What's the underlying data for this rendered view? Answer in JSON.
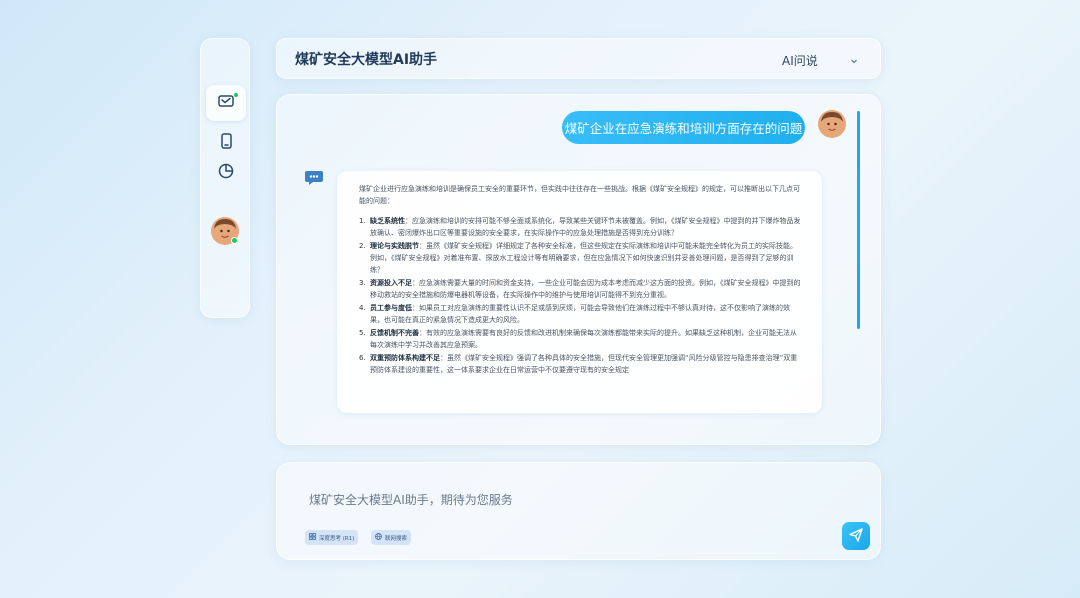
{
  "app": {
    "title": "煤矿安全大模型AI助手"
  },
  "header": {
    "title": "煤矿安全大模型AI助手",
    "mode_label": "AI问说"
  },
  "sidebar": {
    "items": [
      {
        "name": "chat",
        "icon": "mail-check-icon",
        "active": true
      },
      {
        "name": "mobile",
        "icon": "phone-icon",
        "active": false
      },
      {
        "name": "stats",
        "icon": "pie-chart-icon",
        "active": false
      }
    ]
  },
  "chat": {
    "user_message": "煤矿企业在应急演练和培训方面存在的问题",
    "answer_intro": "煤矿企业进行应急演练和培训是确保员工安全的重要环节，但实践中往往存在一些挑战。根据《煤矿安全规程》的规定，可以推断出以下几点可能的问题：",
    "answer_items": [
      {
        "num": "1.",
        "title": "缺乏系统性",
        "text": "：应急演练和培训的安排可能不够全面或系统化，导致某些关键环节未被覆盖。例如，《煤矿安全规程》中提到的井下爆炸物品发放确认、密闭爆炸出口区等重要设施的安全要求，在实际操作中的应急处理措施是否得到充分训练？"
      },
      {
        "num": "2.",
        "title": "理论与实践脱节",
        "text": "：虽然《煤矿安全规程》详细规定了各种安全标准，但这些规定在实际演练和培训中可能未能完全转化为员工的实际技能。例如，《煤矿安全规程》对着准布置、探放水工程设计等有明确要求，但在应急情况下如何快速识别并妥善处理问题，是否得到了足够的训练？"
      },
      {
        "num": "3.",
        "title": "资源投入不足",
        "text": "：应急演练需要大量的时间和资金支持，一些企业可能会因为成本考虑而减少这方面的投资。例如，《煤矿安全规程》中提到的移动救站的安全措施和防爆电器机等设备，在实际操作中的维护与使用培训可能得不到充分重视。"
      },
      {
        "num": "4.",
        "title": "员工参与度低",
        "text": "：如果员工对应急演练的重要性认识不足或感到厌烦，可能会导致他们在演练过程中不够认真对待，这不仅影响了演练的效果，也可能在真正的紧急情况下造成更大的风险。"
      },
      {
        "num": "5.",
        "title": "反馈机制不完善",
        "text": "：有效的应急演练需要有良好的反馈和改进机制来确保每次演练都能带来实际的提升。如果缺乏这种机制，企业可能无法从每次演练中学习并改善其应急预案。"
      },
      {
        "num": "6.",
        "title": "双重预防体系构建不足",
        "text": "：虽然《煤矿安全规程》强调了各种具体的安全措施，但现代安全管理更加强调“风险分级管控与隐患排查治理”双重预防体系建设的重要性，这一体系要求企业在日常运营中不仅要遵守现有的安全规定"
      }
    ]
  },
  "input": {
    "placeholder": "煤矿安全大模型AI助手，期待为您服务",
    "chip_deep_think": "深度思考 (R1)",
    "chip_web_search": "联网搜索"
  },
  "colors": {
    "accent": "#1fb0ee",
    "online": "#22c55e"
  }
}
